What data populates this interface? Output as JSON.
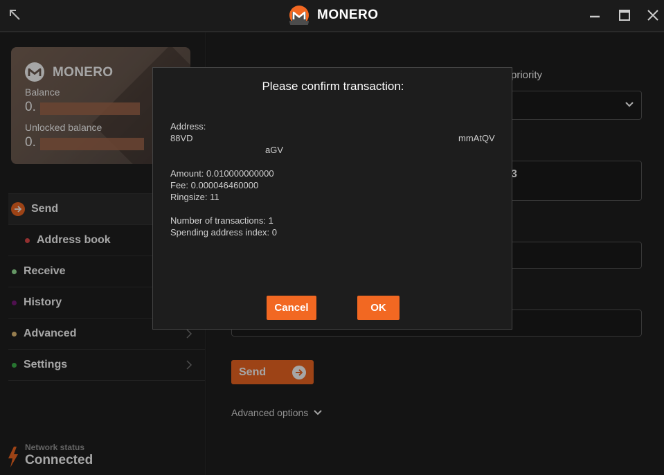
{
  "app": {
    "title": "MONERO"
  },
  "colors": {
    "accent": "#f26822",
    "dot_address_book": "#e24a4a",
    "dot_receive": "#9be89b",
    "dot_history": "#7a1a7a",
    "dot_advanced": "#e8c27a",
    "dot_settings": "#3cb44b"
  },
  "wallet_card": {
    "title": "MONERO",
    "balance_label": "Balance",
    "balance_value": "0.",
    "unlocked_label": "Unlocked balance",
    "unlocked_value": "0."
  },
  "sidebar": {
    "items": [
      {
        "label": "Send"
      },
      {
        "label": "Address book"
      },
      {
        "label": "Receive"
      },
      {
        "label": "History"
      },
      {
        "label": "Advanced"
      },
      {
        "label": "Settings"
      }
    ]
  },
  "network": {
    "label": "Network status",
    "value": "Connected"
  },
  "main": {
    "priority_label_partial": "priority",
    "field_text_partial": "3",
    "send_button": "Send",
    "advanced_options": "Advanced options"
  },
  "dialog": {
    "title": "Please confirm transaction:",
    "address_label": "Address:",
    "address_line1_start": "88VD",
    "address_line1_end": "mmAtQV",
    "address_line2_end": "aGV",
    "amount": "Amount: 0.010000000000",
    "fee": "Fee: 0.000046460000",
    "ringsize": "Ringsize: 11",
    "num_transactions": "Number of transactions: 1",
    "spending_index": "Spending address index: 0",
    "cancel_label": "Cancel",
    "ok_label": "OK"
  }
}
